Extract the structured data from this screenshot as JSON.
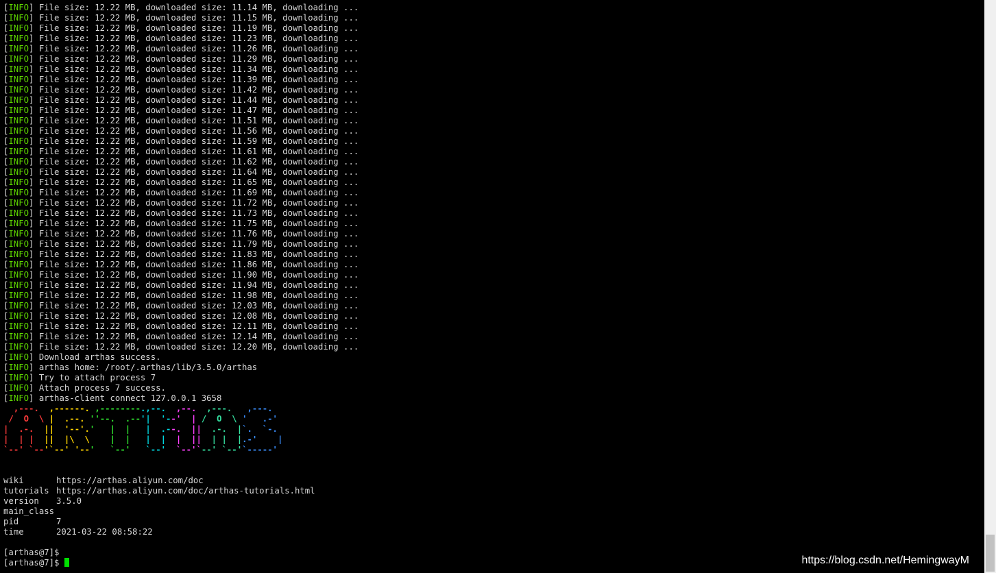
{
  "download_log": [
    "[INFO] File size: 12.22 MB, downloaded size: 11.14 MB, downloading ...",
    "[INFO] File size: 12.22 MB, downloaded size: 11.15 MB, downloading ...",
    "[INFO] File size: 12.22 MB, downloaded size: 11.19 MB, downloading ...",
    "[INFO] File size: 12.22 MB, downloaded size: 11.23 MB, downloading ...",
    "[INFO] File size: 12.22 MB, downloaded size: 11.26 MB, downloading ...",
    "[INFO] File size: 12.22 MB, downloaded size: 11.29 MB, downloading ...",
    "[INFO] File size: 12.22 MB, downloaded size: 11.34 MB, downloading ...",
    "[INFO] File size: 12.22 MB, downloaded size: 11.39 MB, downloading ...",
    "[INFO] File size: 12.22 MB, downloaded size: 11.42 MB, downloading ...",
    "[INFO] File size: 12.22 MB, downloaded size: 11.44 MB, downloading ...",
    "[INFO] File size: 12.22 MB, downloaded size: 11.47 MB, downloading ...",
    "[INFO] File size: 12.22 MB, downloaded size: 11.51 MB, downloading ...",
    "[INFO] File size: 12.22 MB, downloaded size: 11.56 MB, downloading ...",
    "[INFO] File size: 12.22 MB, downloaded size: 11.59 MB, downloading ...",
    "[INFO] File size: 12.22 MB, downloaded size: 11.61 MB, downloading ...",
    "[INFO] File size: 12.22 MB, downloaded size: 11.62 MB, downloading ...",
    "[INFO] File size: 12.22 MB, downloaded size: 11.64 MB, downloading ...",
    "[INFO] File size: 12.22 MB, downloaded size: 11.65 MB, downloading ...",
    "[INFO] File size: 12.22 MB, downloaded size: 11.69 MB, downloading ...",
    "[INFO] File size: 12.22 MB, downloaded size: 11.72 MB, downloading ...",
    "[INFO] File size: 12.22 MB, downloaded size: 11.73 MB, downloading ...",
    "[INFO] File size: 12.22 MB, downloaded size: 11.75 MB, downloading ...",
    "[INFO] File size: 12.22 MB, downloaded size: 11.76 MB, downloading ...",
    "[INFO] File size: 12.22 MB, downloaded size: 11.79 MB, downloading ...",
    "[INFO] File size: 12.22 MB, downloaded size: 11.83 MB, downloading ...",
    "[INFO] File size: 12.22 MB, downloaded size: 11.86 MB, downloading ...",
    "[INFO] File size: 12.22 MB, downloaded size: 11.90 MB, downloading ...",
    "[INFO] File size: 12.22 MB, downloaded size: 11.94 MB, downloading ...",
    "[INFO] File size: 12.22 MB, downloaded size: 11.98 MB, downloading ...",
    "[INFO] File size: 12.22 MB, downloaded size: 12.03 MB, downloading ...",
    "[INFO] File size: 12.22 MB, downloaded size: 12.08 MB, downloading ...",
    "[INFO] File size: 12.22 MB, downloaded size: 12.11 MB, downloading ...",
    "[INFO] File size: 12.22 MB, downloaded size: 12.14 MB, downloading ...",
    "[INFO] File size: 12.22 MB, downloaded size: 12.20 MB, downloading ...",
    "[INFO] Download arthas success.",
    "[INFO] arthas home: /root/.arthas/lib/3.5.0/arthas",
    "[INFO] Try to attach process 7",
    "[INFO] Attach process 7 success.",
    "[INFO] arthas-client connect 127.0.0.1 3658"
  ],
  "logo": {
    "lines": [
      "  ,---.  ,------. ,--------.,--.  ,--.  ,---.   ,---.",
      " /  O  \\ |  .--. ''--.  .--'|  '--'  | /  O  \\ '   .-'",
      "|  .-.  ||  '--'.'   |  |   |  .--.  ||  .-.  |`.  `-.",
      "|  | |  ||  |\\  \\    |  |   |  |  |  ||  | |  |.-'    |",
      "`--' `--'`--' '--'   `--'   `--'  `--'`--' `--'`-----'"
    ],
    "colors": [
      "#ff3b3b",
      "#ffd400",
      "#2fe02f",
      "#00d7e0",
      "#ff40ff",
      "#35e0a0",
      "#3b8fff"
    ]
  },
  "info": [
    {
      "key": "wiki",
      "value": "https://arthas.aliyun.com/doc"
    },
    {
      "key": "tutorials",
      "value": "https://arthas.aliyun.com/doc/arthas-tutorials.html"
    },
    {
      "key": "version",
      "value": "3.5.0"
    },
    {
      "key": "main_class",
      "value": ""
    },
    {
      "key": "pid",
      "value": "7"
    },
    {
      "key": "time",
      "value": "2021-03-22 08:58:22"
    }
  ],
  "prompts": [
    "[arthas@7]$",
    "[arthas@7]$"
  ],
  "watermark": "https://blog.csdn.net/HemingwayM",
  "colors": {
    "background": "#000000",
    "text": "#d8d8d8",
    "info_tag": "#5fd700",
    "cursor": "#00e000"
  }
}
